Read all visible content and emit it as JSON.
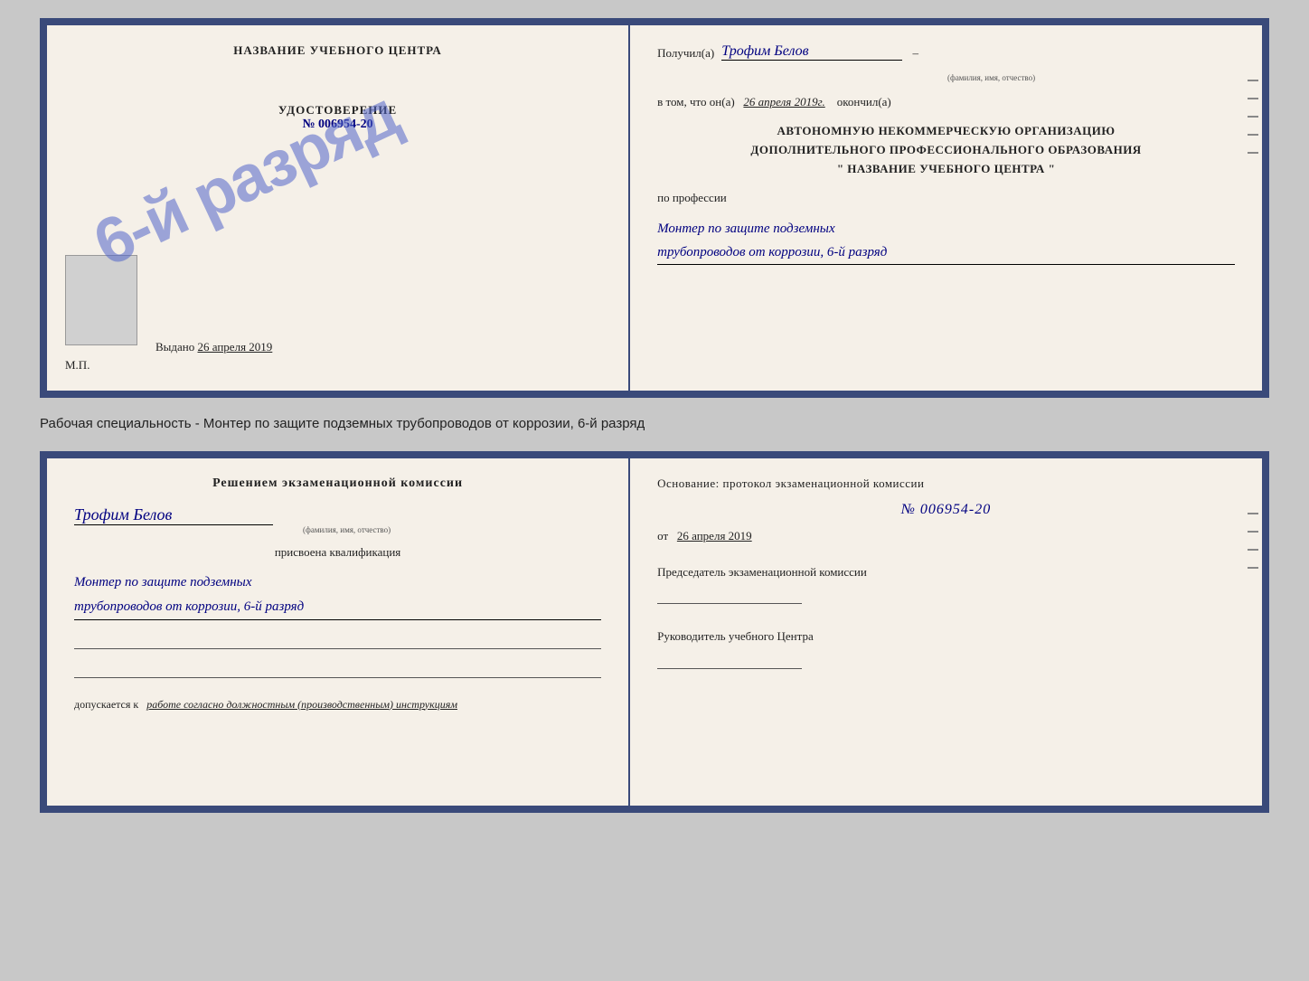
{
  "top_cert": {
    "left": {
      "title": "НАЗВАНИЕ УЧЕБНОГО ЦЕНТРА",
      "stamp_text": "6-й разряд",
      "udostoverenie_label": "УДОСТОВЕРЕНИЕ",
      "udostoverenie_num": "№ 006954-20",
      "vydano_label": "Выдано",
      "vydano_date": "26 апреля 2019",
      "mp": "М.П."
    },
    "right": {
      "poluchil_label": "Получил(a)",
      "recipient_name": "Трофим Белов",
      "recipient_sublabel": "(фамилия, имя, отчество)",
      "vtom_label": "в том, что он(а)",
      "date_value": "26 апреля 2019г.",
      "okonchil_label": "окончил(а)",
      "org_line1": "АВТОНОМНУЮ НЕКОММЕРЧЕСКУЮ ОРГАНИЗАЦИЮ",
      "org_line2": "ДОПОЛНИТЕЛЬНОГО ПРОФЕССИОНАЛЬНОГО ОБРАЗОВАНИЯ",
      "org_line3": "\"  НАЗВАНИЕ УЧЕБНОГО ЦЕНТРА  \"",
      "po_professii_label": "по профессии",
      "profession_line1": "Монтер по защите подземных",
      "profession_line2": "трубопроводов от коррозии, 6-й разряд"
    }
  },
  "subtitle": "Рабочая специальность - Монтер по защите подземных трубопроводов от коррозии, 6-й разряд",
  "bottom_cert": {
    "left": {
      "decision_title": "Решением экзаменационной комиссии",
      "name_value": "Трофим Белов",
      "name_sublabel": "(фамилия, имя, отчество)",
      "assigned_text": "присвоена квалификация",
      "qualification_line1": "Монтер по защите подземных",
      "qualification_line2": "трубопроводов от коррозии, 6-й разряд",
      "dopuskaetsya_label": "допускается к",
      "dopuskaetsya_value": "работе согласно должностным (производственным) инструкциям"
    },
    "right": {
      "osnovaniye_label": "Основание: протокол экзаменационной комиссии",
      "protocol_num": "№  006954-20",
      "ot_label": "от",
      "ot_date": "26 апреля 2019",
      "chairman_label": "Председатель экзаменационной комиссии",
      "rukov_label": "Руководитель учебного Центра"
    }
  }
}
